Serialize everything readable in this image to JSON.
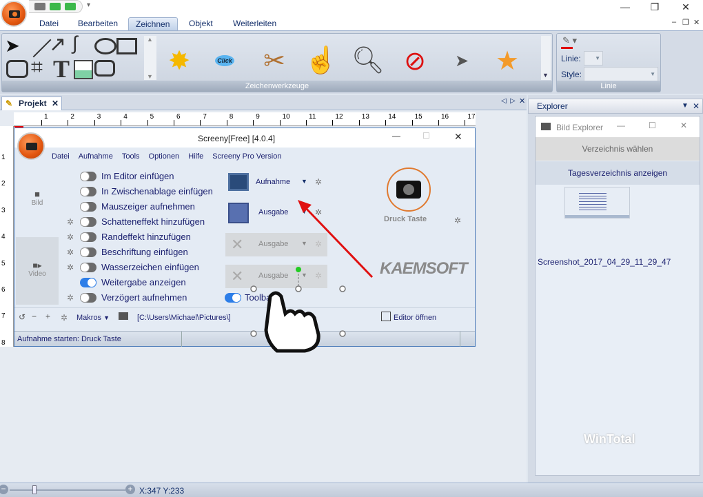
{
  "titlebar": {
    "controls": [
      "minimize",
      "restore",
      "close"
    ]
  },
  "menu_tabs": [
    {
      "label": "Datei"
    },
    {
      "label": "Bearbeiten"
    },
    {
      "label": "Zeichnen",
      "selected": true
    },
    {
      "label": "Objekt"
    },
    {
      "label": "Weiterleiten"
    }
  ],
  "ribbon": {
    "group_draw_label": "Zeichenwerkzeuge",
    "text_tool": "T",
    "click_label": "Click",
    "group_line_label": "Linie",
    "linie_label": "Linie:",
    "style_label": "Style:",
    "line_color": "#e00000"
  },
  "doc": {
    "tab_label": "Projekt",
    "ruler_h": [
      "1",
      "2",
      "3",
      "4",
      "5",
      "6",
      "7",
      "8",
      "9",
      "10",
      "11",
      "12",
      "13",
      "14",
      "15",
      "16",
      "17"
    ],
    "ruler_v": [
      "1",
      "2",
      "3",
      "4",
      "5",
      "6",
      "7",
      "8"
    ]
  },
  "screeny": {
    "title": "Screeny[Free] [4.0.4]",
    "menu": [
      "Datei",
      "Aufnahme",
      "Tools",
      "Optionen",
      "Hilfe",
      "Screeny Pro Version"
    ],
    "side": {
      "bild": "Bild",
      "video": "Video"
    },
    "options": [
      {
        "label": "Im Editor einfügen",
        "on": false,
        "gear": false
      },
      {
        "label": "In Zwischenablage einfügen",
        "on": false,
        "gear": false
      },
      {
        "label": "Mauszeiger aufnehmen",
        "on": false,
        "gear": false
      },
      {
        "label": "Schatteneffekt hinzufügen",
        "on": false,
        "gear": true
      },
      {
        "label": "Randeffekt hinzufügen",
        "on": false,
        "gear": true
      },
      {
        "label": "Beschriftung einfügen",
        "on": false,
        "gear": true
      },
      {
        "label": "Wasserzeichen einfügen",
        "on": false,
        "gear": true
      },
      {
        "label": "Weitergabe anzeigen",
        "on": true,
        "gear": false
      },
      {
        "label": "Verzögert aufnehmen",
        "on": false,
        "gear": true
      }
    ],
    "buttons": [
      {
        "label": "Aufnahme",
        "enabled": true
      },
      {
        "label": "Ausgabe",
        "enabled": true
      },
      {
        "label": "Ausgabe",
        "enabled": false
      },
      {
        "label": "Ausgabe",
        "enabled": false
      }
    ],
    "toolbar_toggle": "Toolbar",
    "druck_taste": "Druck Taste",
    "logo": "KAEMSOFT",
    "makros": "Makros",
    "path": "[C:\\Users\\Michael\\Pictures\\]",
    "editor_open": "Editor öffnen",
    "status": "Aufnahme starten: Druck Taste"
  },
  "explorer": {
    "title": "Explorer",
    "window_title": "Bild Explorer",
    "choose_dir": "Verzeichnis wählen",
    "today_dir": "Tagesverzeichnis anzeigen",
    "file_name": "Screenshot_2017_04_29_11_29_47",
    "watermark": "WinTotal"
  },
  "statusbar": {
    "coords": "X:347 Y:233"
  }
}
